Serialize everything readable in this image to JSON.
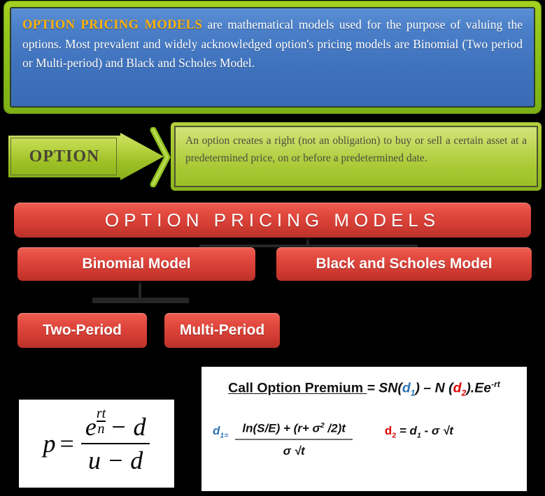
{
  "intro": {
    "highlight": "OPTION PRICING MODELS",
    "body": " are mathematical models used for the purpose of valuing the options. Most prevalent and widely acknowledged option's pricing models are Binomial (Two period or Multi-period) and Black and Scholes Model."
  },
  "option_callout": {
    "arrow_label": "OPTION",
    "text": "An option creates a right (not an obligation) to buy or sell a certain asset at a predetermined price, on or before a predetermined date."
  },
  "chart_data": {
    "type": "table",
    "title": "OPTION PRICING MODELS",
    "nodes": [
      {
        "id": "root",
        "label": "OPTION PRICING MODELS",
        "level": 0
      },
      {
        "id": "binomial",
        "label": "Binomial Model",
        "level": 1,
        "parent": "root"
      },
      {
        "id": "blackscholes",
        "label": "Black and Scholes Model",
        "level": 1,
        "parent": "root"
      },
      {
        "id": "twoperiod",
        "label": "Two-Period",
        "level": 2,
        "parent": "binomial"
      },
      {
        "id": "multiperiod",
        "label": "Multi-Period",
        "level": 2,
        "parent": "binomial"
      }
    ]
  },
  "flow": {
    "title": "OPTION PRICING MODELS",
    "binomial": "Binomial Model",
    "black_scholes": "Black and Scholes Model",
    "two_period": "Two-Period",
    "multi_period": "Multi-Period"
  },
  "formula_binomial": {
    "p": "p",
    "equals": "=",
    "num_e": "e",
    "exp_num": "rt",
    "exp_den": "n",
    "num_minus_d": "− d",
    "denominator": "u − d"
  },
  "formula_black_scholes": {
    "line1_label": "Call Option Premium ",
    "line1_eq": "= ",
    "line1_sn": "SN(",
    "line1_d1": "d",
    "line1_d1_sub": "1",
    "line1_mid": ") – N (",
    "line1_d2": "d",
    "line1_d2_sub": "2",
    "line1_tail": ").Ee",
    "line1_sup": "-rt",
    "d1_label": "d",
    "d1_sub": "1",
    "d1_eq": "=",
    "d1_numerator": "ln(S/E) + (r+ σ",
    "d1_num_sup": "2",
    "d1_num_tail": " /2)t",
    "d1_denominator": "σ √t",
    "d2_label": "d",
    "d2_sub": "2",
    "d2_expr": " = d",
    "d2_expr_sub": "1",
    "d2_tail": "  - σ √t"
  },
  "colors": {
    "background": "#000000",
    "intro_frame_green": "#8cc01a",
    "intro_blue": "#4a7fc8",
    "intro_highlight": "#ffb20a",
    "callout_green": "#a8c833",
    "node_red": "#e34a40",
    "connector": "#262626",
    "d1_blue": "#2e74b5",
    "d2_red": "#e00000"
  }
}
